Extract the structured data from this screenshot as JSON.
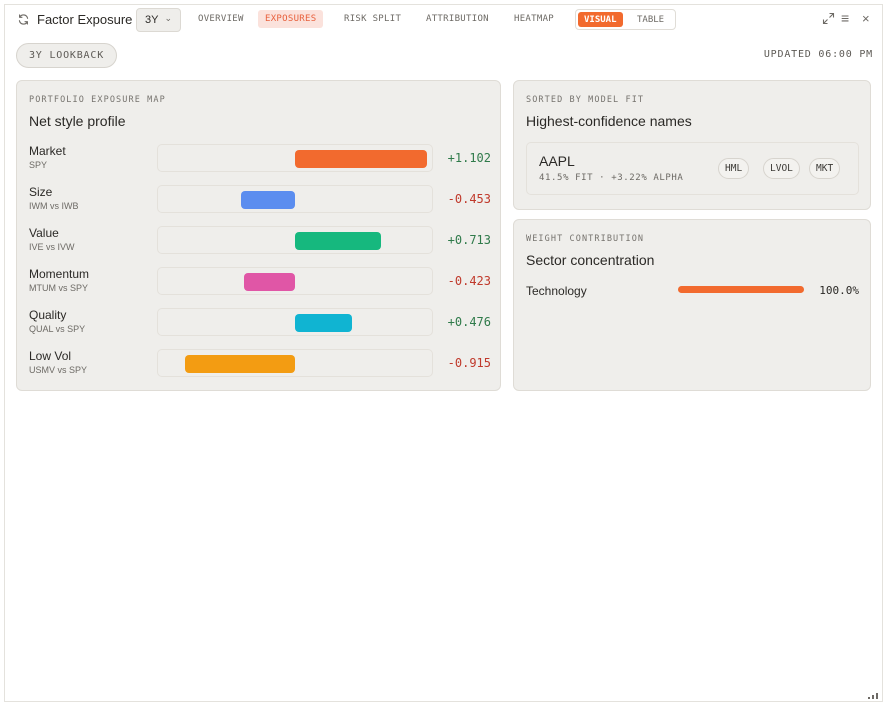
{
  "header": {
    "title": "Factor Exposure",
    "range": "3Y",
    "tabs": [
      "OVERVIEW",
      "EXPOSURES",
      "RISK SPLIT",
      "ATTRIBUTION",
      "HEATMAP"
    ],
    "active_tab": "EXPOSURES",
    "view_toggle": {
      "visual": "VISUAL",
      "table": "TABLE",
      "active": "VISUAL"
    }
  },
  "subheader": {
    "lookback": "3Y LOOKBACK",
    "updated": "UPDATED 06:00 PM"
  },
  "exposure_card": {
    "eyebrow": "PORTFOLIO EXPOSURE MAP",
    "title": "Net style profile",
    "factors": [
      {
        "name": "Market",
        "proxy": "SPY",
        "value": 1.102,
        "label": "+1.102",
        "color": "#f26a2e"
      },
      {
        "name": "Size",
        "proxy": "IWM vs IWB",
        "value": -0.453,
        "label": "-0.453",
        "color": "#5b8def"
      },
      {
        "name": "Value",
        "proxy": "IVE vs IVW",
        "value": 0.713,
        "label": "+0.713",
        "color": "#16b87e"
      },
      {
        "name": "Momentum",
        "proxy": "MTUM vs SPY",
        "value": -0.423,
        "label": "-0.423",
        "color": "#e056a6"
      },
      {
        "name": "Quality",
        "proxy": "QUAL vs SPY",
        "value": 0.476,
        "label": "+0.476",
        "color": "#10b4d2"
      },
      {
        "name": "Low Vol",
        "proxy": "USMV vs SPY",
        "value": -0.915,
        "label": "-0.915",
        "color": "#f39c12"
      }
    ]
  },
  "fit_card": {
    "eyebrow": "SORTED BY MODEL FIT",
    "title": "Highest-confidence names",
    "names": [
      {
        "ticker": "AAPL",
        "meta": "41.5% FIT · +3.22% ALPHA",
        "chips": [
          "HML",
          "LVOL",
          "MKT"
        ]
      }
    ]
  },
  "weight_card": {
    "eyebrow": "WEIGHT CONTRIBUTION",
    "title": "Sector concentration",
    "sectors": [
      {
        "name": "Technology",
        "weight": 1.0,
        "label": "100.0%"
      }
    ]
  }
}
